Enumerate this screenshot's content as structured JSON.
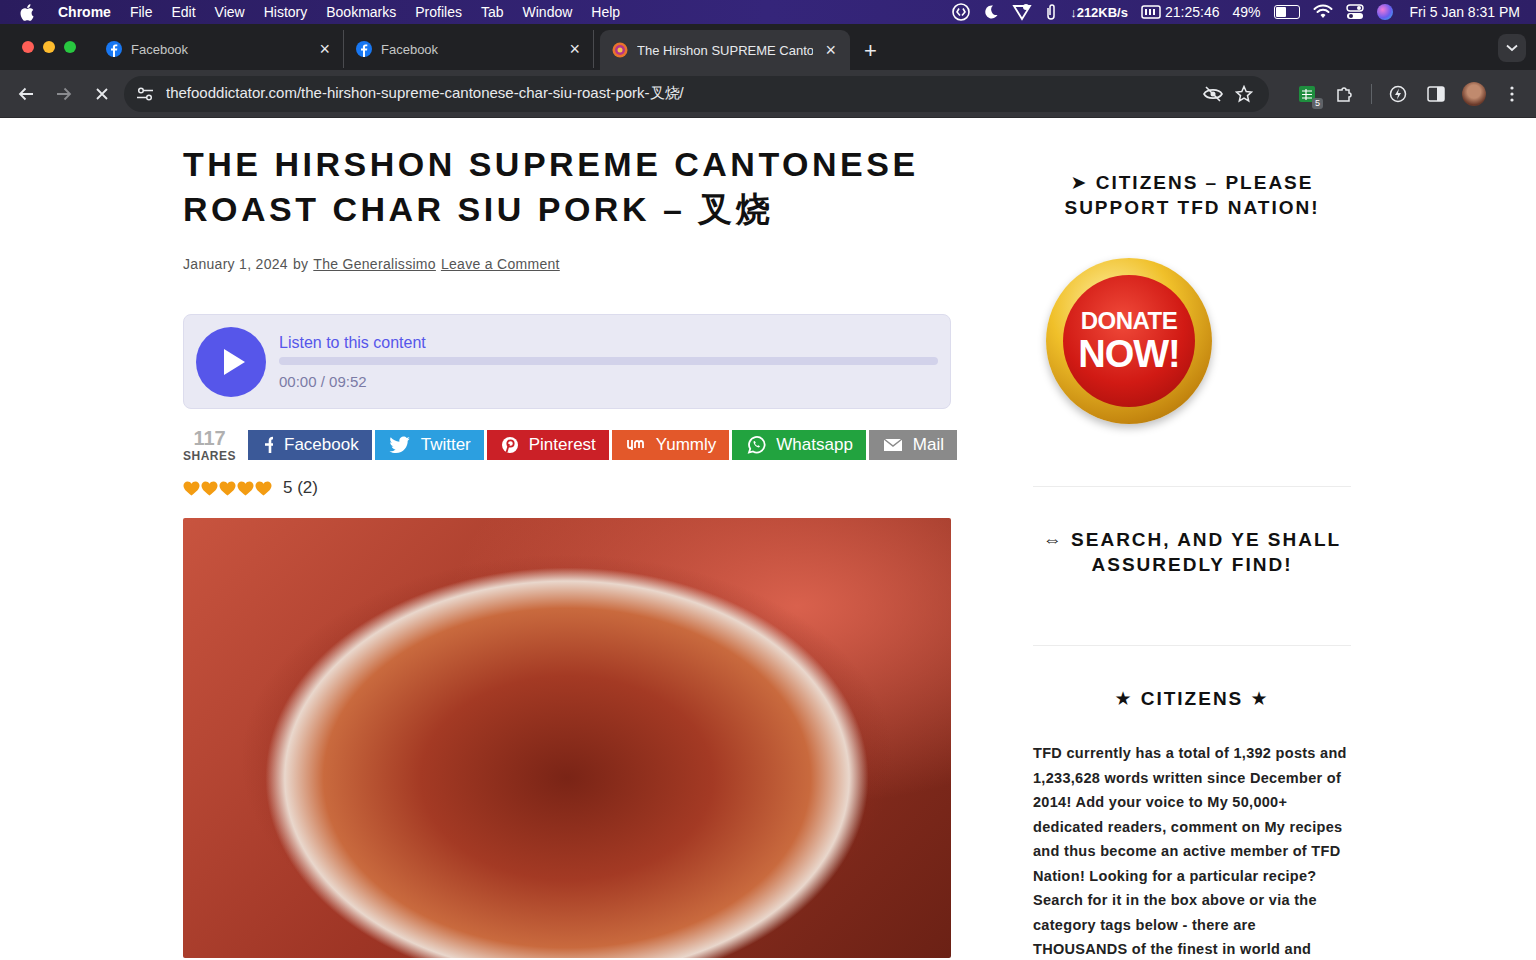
{
  "menubar": {
    "app": "Chrome",
    "items": [
      "File",
      "Edit",
      "View",
      "History",
      "Bookmarks",
      "Profiles",
      "Tab",
      "Window",
      "Help"
    ],
    "network": "↓212KB/s",
    "timer": "21:25:46",
    "battery": {
      "reading": "49%",
      "level": 0.49
    },
    "clock": "Fri 5 Jan  8:31 PM"
  },
  "tabs": [
    {
      "label": "Facebook",
      "close": "×",
      "kind": "facebook",
      "selected": false
    },
    {
      "label": "Facebook",
      "close": "×",
      "kind": "facebook",
      "selected": false
    },
    {
      "label": "The Hirshon SUPREME Canto",
      "close": "×",
      "kind": "site",
      "selected": true
    }
  ],
  "new_tab": "+",
  "toolbar": {
    "url": "thefooddictator.com/the-hirshon-supreme-cantonese-char-siu-roast-pork-叉烧/",
    "loading": true,
    "extension_badge": "5"
  },
  "article": {
    "title": "THE HIRSHON SUPREME CANTONESE ROAST CHAR SIU PORK – 叉烧",
    "date": "January 1, 2024",
    "by": "by",
    "author": "The Generalissimo",
    "comment_link": "Leave a Comment",
    "player": {
      "label": "Listen to this content",
      "time": "00:00 / 09:52",
      "level": 0,
      "playing": false
    },
    "shares": {
      "count": "117",
      "label": "SHARES",
      "buttons": [
        {
          "label": "Facebook",
          "kind": "facebook",
          "color": "#3b5998"
        },
        {
          "label": "Twitter",
          "kind": "twitter",
          "color": "#2c9fe0"
        },
        {
          "label": "Pinterest",
          "kind": "pinterest",
          "color": "#cb2027"
        },
        {
          "label": "Yummly",
          "kind": "yummly",
          "color": "#e3582a"
        },
        {
          "label": "Whatsapp",
          "kind": "whatsapp",
          "color": "#22a33f"
        },
        {
          "label": "Mail",
          "kind": "mail",
          "color": "#8a8a8a"
        }
      ]
    },
    "rating": {
      "stars": 5,
      "reading": "5 (2)"
    }
  },
  "sidebar": {
    "support_heading": "➤ CITIZENS – PLEASE SUPPORT TFD NATION!",
    "donate": [
      "DONATE",
      "NOW!"
    ],
    "search_heading": "⇔ SEARCH, AND YE SHALL ASSUREDLY FIND!",
    "citizens_heading": "★ CITIZENS ★",
    "citizens_text": "TFD currently has a total of 1,392 posts and 1,233,628 words written since December of 2014! Add your voice to My 50,000+ dedicated readers, comment on My recipes and thus become an active member of TFD Nation! Looking for a particular recipe? Search for it in the box above or via the category tags below - there are THOUSANDS of the finest in world and"
  }
}
